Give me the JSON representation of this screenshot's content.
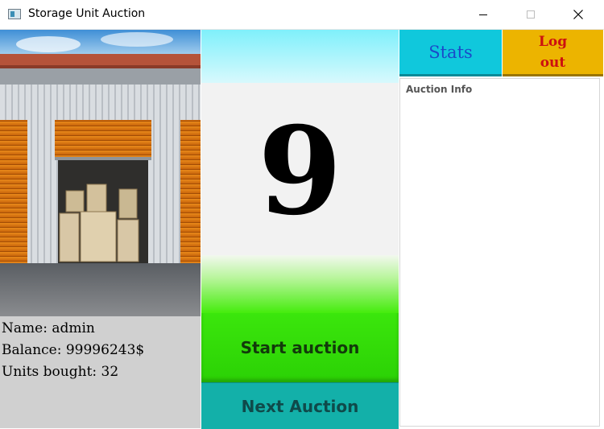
{
  "window": {
    "title": "Storage Unit Auction"
  },
  "user": {
    "name_line": "Name: admin",
    "balance_line": "Balance: 99996243$",
    "units_line": "Units bought: 32"
  },
  "auction": {
    "countdown": "9",
    "start_label": "Start auction",
    "next_label": "Next Auction",
    "info_label": "Auction Info"
  },
  "buttons": {
    "stats_label": "Stats",
    "logout_line1": "Log",
    "logout_line2": "out"
  },
  "colors": {
    "start_green": "#2bd105",
    "next_teal": "#13b0a9",
    "stats_cyan": "#10c8dc",
    "logout_amber": "#ecb400",
    "logout_text": "#cc1010",
    "stats_text": "#1b4ac9"
  },
  "icons": [
    "app-icon",
    "minimize-icon",
    "maximize-icon",
    "close-icon"
  ]
}
